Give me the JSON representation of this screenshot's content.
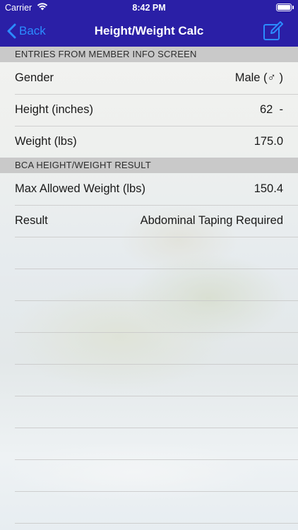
{
  "status_bar": {
    "carrier": "Carrier",
    "time": "8:42 PM"
  },
  "nav": {
    "back_label": "Back",
    "title": "Height/Weight Calc",
    "compose_icon": "compose-icon"
  },
  "colors": {
    "nav_background": "#2a1fa6",
    "back_tint": "#2b8cff",
    "section_header_bg": "#c9c9c9"
  },
  "member_info": {
    "header": "ENTRIES FROM MEMBER INFO SCREEN",
    "gender_label": "Gender",
    "gender_value": "Male (♂ )",
    "height_label": "Height (inches)",
    "height_value": "62  -",
    "weight_label": "Weight (lbs)",
    "weight_value": "175.0"
  },
  "result_section": {
    "header": "BCA HEIGHT/WEIGHT RESULT",
    "max_weight_label": "Max Allowed Weight (lbs)",
    "max_weight_value": "150.4",
    "result_label": "Result",
    "result_value": "Abdominal Taping Required"
  }
}
